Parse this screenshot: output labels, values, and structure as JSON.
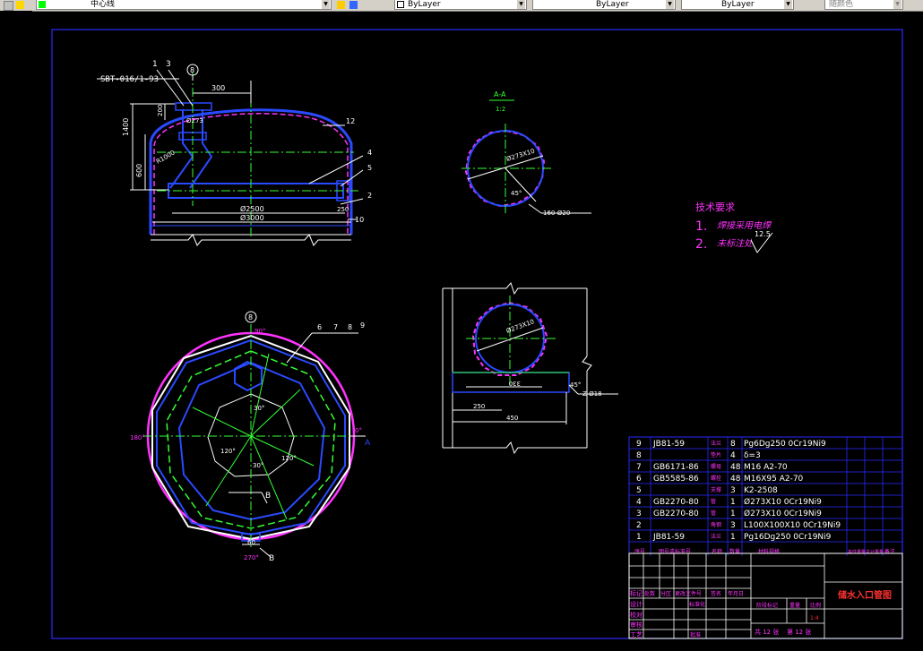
{
  "toolbar": {
    "layer_name": "中心线",
    "color": "ByLayer",
    "linetype": "ByLayer",
    "lineweight": "ByLayer",
    "plotstyle": "随颜色"
  },
  "elevation_view": {
    "callout_1": "1",
    "callout_3": "3",
    "callout_8": "8",
    "std_label": "SBT-016/1-93",
    "dim_300": "300",
    "dim_1400": "1400",
    "dim_600": "600",
    "dim_200": "200",
    "dim_inner": "Ø273",
    "dim_2500": "Ø2500",
    "dim_3000": "Ø3000",
    "dim_250": "250",
    "callout_12": "12",
    "callout_4": "4",
    "callout_5": "5",
    "callout_2": "2",
    "callout_10": "10",
    "r_label": "R1000"
  },
  "section_aa": {
    "title": "A-A",
    "scale": "1:2",
    "dim_273": "Ø273X10",
    "angle": "45°",
    "note": "160-Ø20"
  },
  "tech_requirements": {
    "title": "技术要求",
    "item1_num": "1.",
    "item1_text": "焊接采用电焊",
    "item2_num": "2.",
    "item2_text": "未标注处",
    "roughness": "12.5"
  },
  "detail_view": {
    "dim_273": "Ø273X10",
    "dim_330": "330",
    "dim_250": "250",
    "dim_450": "450",
    "note_z": "Z-Ø18",
    "angle": "45°"
  },
  "plan_view": {
    "callout_8": "8",
    "callout_6": "6",
    "callout_7": "7",
    "callout_8b": "8",
    "callout_9": "9",
    "angle_90": "90°",
    "angle_180": "180°",
    "angle_0": "0°",
    "angle_270": "270°",
    "label_a": "A",
    "label_b": "B",
    "label_b2": "B",
    "deg_30": "30°",
    "deg_120a": "120°",
    "deg_120b": "120°",
    "deg_30b": "30°",
    "dim_60": "60"
  },
  "bom": {
    "rows": [
      {
        "no": "9",
        "code": "JB81-59",
        "name": "法兰",
        "qty": "8",
        "spec": "Pg6Dg250 0Cr19Ni9"
      },
      {
        "no": "8",
        "code": "",
        "name": "垫片",
        "qty": "4",
        "spec": "δ=3"
      },
      {
        "no": "7",
        "code": "GB6171-86",
        "name": "螺母",
        "qty": "48",
        "spec": "M16 A2-70"
      },
      {
        "no": "6",
        "code": "GB5585-86",
        "name": "螺栓",
        "qty": "48",
        "spec": "M16X95 A2-70"
      },
      {
        "no": "5",
        "code": "",
        "name": "支撑",
        "qty": "3",
        "spec": "K2-2508"
      },
      {
        "no": "4",
        "code": "GB2270-80",
        "name": "管",
        "qty": "1",
        "spec": "Ø273X10 0Cr19Ni9"
      },
      {
        "no": "3",
        "code": "GB2270-80",
        "name": "管",
        "qty": "1",
        "spec": "Ø273X10 0Cr19Ni9"
      },
      {
        "no": "2",
        "code": "",
        "name": "角钢",
        "qty": "3",
        "spec": "L100X100X10 0Cr19Ni9"
      },
      {
        "no": "1",
        "code": "JB81-59",
        "name": "法兰",
        "qty": "1",
        "spec": "Pg16Dg250 0Cr19Ni9"
      }
    ],
    "header": {
      "no": "序号",
      "code": "图号或标准号",
      "name": "名称",
      "qty": "数量",
      "spec": "材料规格",
      "weight": "单件重量",
      "total": "总计重量",
      "note": "备注"
    }
  },
  "title_block": {
    "drawing_title": "储水入口管图",
    "row_labels": [
      "标记",
      "设计",
      "校对",
      "审核",
      "工艺"
    ],
    "col_labels": [
      "处数",
      "分区",
      "更改文件号",
      "签名",
      "年月日"
    ],
    "std_label": "标准化",
    "approve": "批准",
    "stage": "阶段标记",
    "weight": "重量",
    "scale": "比例",
    "scale_val": "1:4",
    "sheets_total": "共 12 张",
    "sheet_no": "第 12 张"
  },
  "colors": {
    "frame": "#2a2aff",
    "white": "#ffffff",
    "magenta": "#ff33ff",
    "green": "#33ff33",
    "blue": "#3355ff",
    "cyan": "#00ffff",
    "red": "#ff3030",
    "yellow": "#ffff33"
  }
}
